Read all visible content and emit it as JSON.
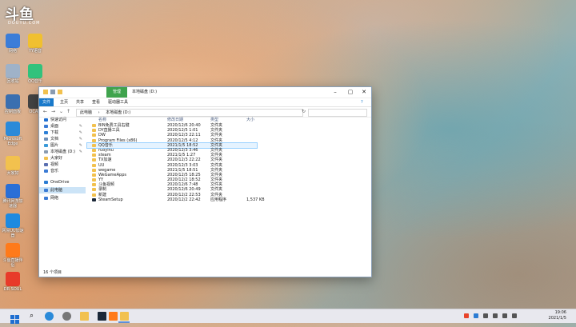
{
  "desktop": {
    "logo": {
      "text": "斗鱼",
      "sub": "DOUYU.COM"
    },
    "icons": [
      {
        "label": "网络",
        "icon": "network-icon",
        "color": "#3b7dd8"
      },
      {
        "label": "YY语音",
        "icon": "yy-icon",
        "color": "#f0c030"
      },
      {
        "label": "回收站",
        "icon": "recycle-bin-icon",
        "color": "#9fb2c8"
      },
      {
        "label": "QQ音乐",
        "icon": "qqmusic-icon",
        "color": "#31c27c"
      },
      {
        "label": "控制面板",
        "icon": "control-panel-icon",
        "color": "#3a6fb0"
      },
      {
        "label": "OCAM",
        "icon": "ocam-icon",
        "color": "#444"
      },
      {
        "label": "Microsoft Edge",
        "icon": "edge-icon",
        "color": "#2b8ad9"
      },
      {
        "label": "大家好",
        "icon": "folder-icon",
        "color": "#f2c14e"
      },
      {
        "label": "腾讯网游加速器",
        "icon": "tencent-accelerator-icon",
        "color": "#2a6fd6"
      },
      {
        "label": "网易UU加速器",
        "icon": "uu-accelerator-icon",
        "color": "#1e8ae0"
      },
      {
        "label": "斗鱼直播伴侣",
        "icon": "douyu-companion-icon",
        "color": "#ff7a1a"
      },
      {
        "label": "DR SOUL",
        "icon": "dr-soul-icon",
        "color": "#e83a2a"
      }
    ]
  },
  "window": {
    "context_tab": "管理",
    "title": "本地磁盘 (D:)",
    "ribbon_tabs": [
      "文件",
      "主页",
      "共享",
      "查看",
      "驱动器工具"
    ],
    "breadcrumb": [
      "此电脑",
      "本地磁盘 (D:)"
    ],
    "search_placeholder": "",
    "columns": [
      "名称",
      "修改日期",
      "类型",
      "大小"
    ],
    "nav": [
      {
        "label": "快速访问",
        "icon": "star-icon",
        "color": "#1f6fd1",
        "pin": ""
      },
      {
        "label": "桌面",
        "icon": "desktop-icon",
        "color": "#3a7bd5",
        "pin": "✎"
      },
      {
        "label": "下载",
        "icon": "download-icon",
        "color": "#2d7fd6",
        "pin": "✎"
      },
      {
        "label": "文档",
        "icon": "document-icon",
        "color": "#6d8fb9",
        "pin": "✎"
      },
      {
        "label": "图片",
        "icon": "picture-icon",
        "color": "#3a9ad9",
        "pin": "✎"
      },
      {
        "label": "本地磁盘 (D:)",
        "icon": "drive-icon",
        "color": "#8a9bb0",
        "pin": "✎"
      },
      {
        "label": "大家好",
        "icon": "folder-icon",
        "color": "#f2c14e",
        "pin": ""
      },
      {
        "label": "视频",
        "icon": "video-icon",
        "color": "#5a6fb0",
        "pin": ""
      },
      {
        "label": "音乐",
        "icon": "music-icon",
        "color": "#3a7bd5",
        "pin": ""
      },
      {
        "label": "OneDrive",
        "icon": "onedrive-icon",
        "color": "#2b7cd3",
        "pin": ""
      },
      {
        "label": "此电脑",
        "icon": "this-pc-icon",
        "color": "#3a7bd5",
        "pin": "",
        "selected": true
      },
      {
        "label": "网络",
        "icon": "network-icon",
        "color": "#3a7bd5",
        "pin": ""
      }
    ],
    "files": [
      {
        "name": "BIN免费工具右键",
        "date": "2020/12/6 20:40",
        "type": "文件夹",
        "size": ""
      },
      {
        "name": "DY直播工具",
        "date": "2020/12/5 1:01",
        "type": "文件夹",
        "size": ""
      },
      {
        "name": "DW",
        "date": "2020/12/3 22:11",
        "type": "文件夹",
        "size": ""
      },
      {
        "name": "Program Files (x86)",
        "date": "2020/12/5 4:12",
        "type": "文件夹",
        "size": ""
      },
      {
        "name": "QQ音乐",
        "date": "2021/1/5 18:52",
        "type": "文件夹",
        "size": "",
        "highlight": true
      },
      {
        "name": "ruoyinu",
        "date": "2020/12/3 3:46",
        "type": "文件夹",
        "size": ""
      },
      {
        "name": "steam",
        "date": "2021/1/5 1:27",
        "type": "文件夹",
        "size": ""
      },
      {
        "name": "TX加速",
        "date": "2020/12/3 22:22",
        "type": "文件夹",
        "size": ""
      },
      {
        "name": "UU",
        "date": "2020/12/3 3:03",
        "type": "文件夹",
        "size": ""
      },
      {
        "name": "wegame",
        "date": "2021/1/5 18:51",
        "type": "文件夹",
        "size": ""
      },
      {
        "name": "WeGameApps",
        "date": "2020/12/5 18:25",
        "type": "文件夹",
        "size": ""
      },
      {
        "name": "YY",
        "date": "2020/12/2 18:52",
        "type": "文件夹",
        "size": ""
      },
      {
        "name": "斗鱼视频",
        "date": "2020/12/6 7:48",
        "type": "文件夹",
        "size": ""
      },
      {
        "name": "录制",
        "date": "2020/12/6 20:49",
        "type": "文件夹",
        "size": ""
      },
      {
        "name": "新建",
        "date": "2020/12/2 22:53",
        "type": "文件夹",
        "size": ""
      },
      {
        "name": "SteamSetup",
        "date": "2020/12/2 22:42",
        "type": "应用程序",
        "size": "1,537 KB",
        "app": true
      }
    ],
    "status": "16 个项目"
  },
  "taskbar": {
    "clock_time": "19:06",
    "clock_date": "2021/1/5",
    "tray_icons": [
      "sougou-ime-icon",
      "tray-icon-2",
      "tray-icon-3",
      "network-tray-icon",
      "volume-icon",
      "notification-icon"
    ]
  }
}
